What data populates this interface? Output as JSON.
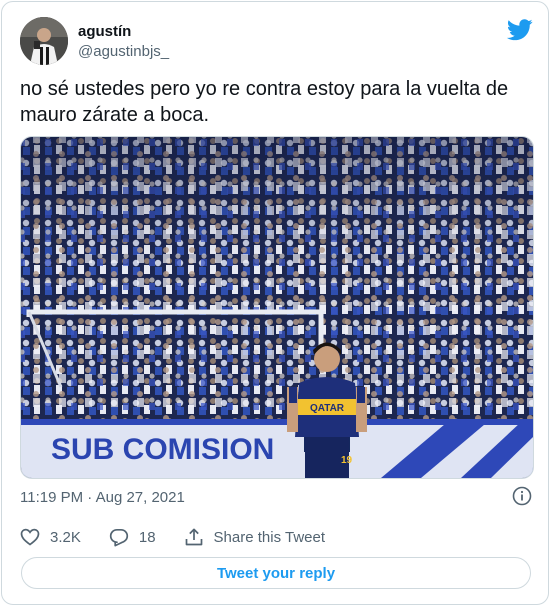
{
  "author": {
    "display_name": "agustín",
    "handle": "@agustinbjs_",
    "avatar_icon": "profile-photo"
  },
  "brand": {
    "icon": "twitter-bird-icon",
    "color": "#1d9bf0"
  },
  "tweet": {
    "text": "no sé ustedes pero yo re contra estoy para la vuelta de mauro zárate a boca.",
    "timestamp": "11:19 PM · Aug 27, 2021"
  },
  "media": {
    "banner_text": "SUB COMISION",
    "sponsor_text": "QATAR",
    "shirt_number": "19"
  },
  "actions": {
    "like_count": "3.2K",
    "reply_count": "18",
    "share_label": "Share this Tweet"
  },
  "reply_button": {
    "label": "Tweet your reply"
  },
  "colors": {
    "text_primary": "#0f1419",
    "text_secondary": "#536471",
    "accent": "#1d9bf0",
    "border": "#cfd9de"
  }
}
